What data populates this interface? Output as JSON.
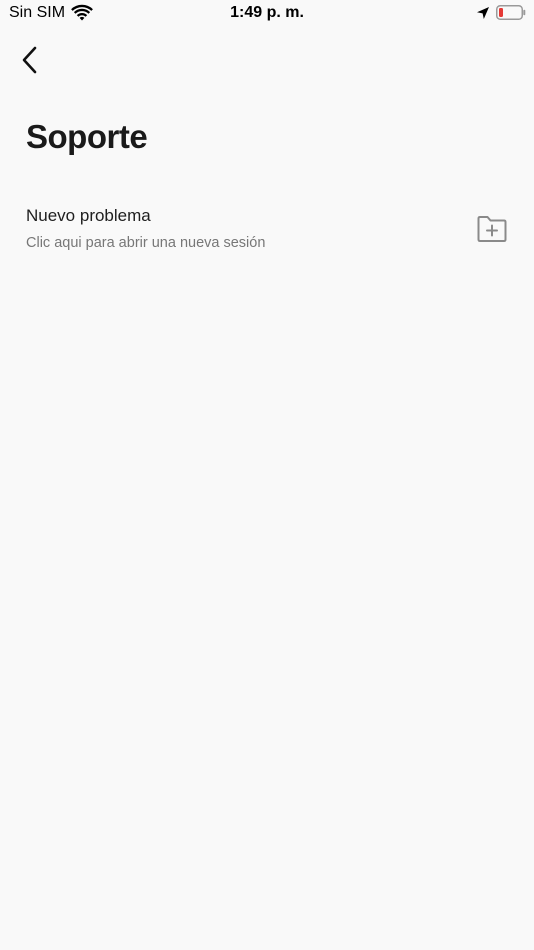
{
  "status_bar": {
    "carrier": "Sin SIM",
    "time": "1:49 p. m.",
    "icons": [
      "wifi-icon",
      "location-arrow-icon",
      "battery-low-icon"
    ],
    "battery_color": "#e53935"
  },
  "nav": {
    "back_icon": "chevron-left-icon"
  },
  "page": {
    "title": "Soporte"
  },
  "items": [
    {
      "title": "Nuevo problema",
      "subtitle": "Clic aqui para abrir una nueva sesión",
      "icon": "folder-plus-icon"
    }
  ],
  "colors": {
    "background": "#f9f9f9",
    "text_primary": "#1a1a1a",
    "text_secondary": "#777777",
    "icon_gray": "#8a8a8a"
  }
}
